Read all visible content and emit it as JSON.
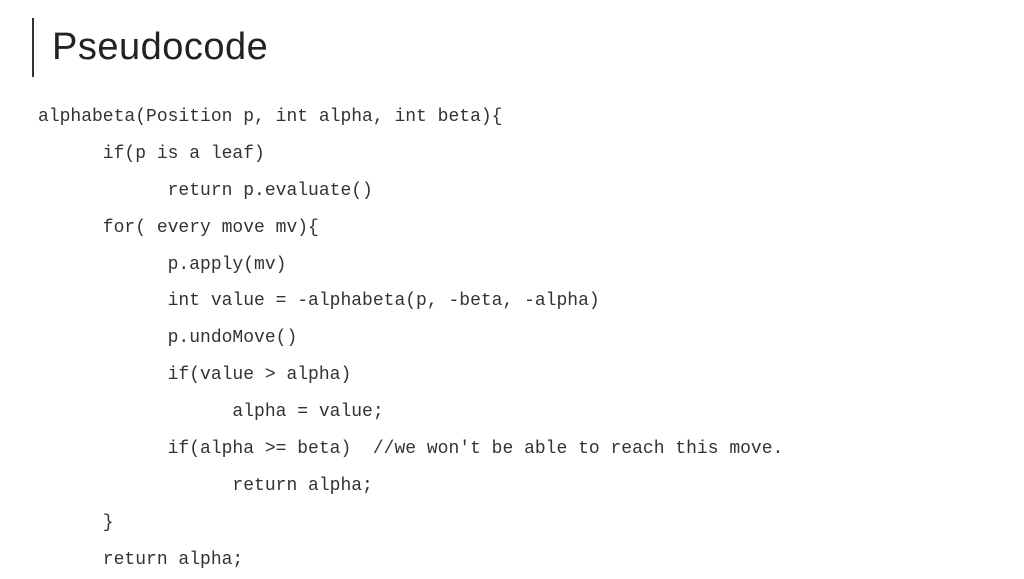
{
  "slide": {
    "title": "Pseudocode",
    "code": {
      "line1": "alphabeta(Position p, int alpha, int beta){",
      "line2": "      if(p is a leaf)",
      "line3": "            return p.evaluate()",
      "line4": "      for( every move mv){",
      "line5": "            p.apply(mv)",
      "line6": "            int value = -alphabeta(p, -beta, -alpha)",
      "line7": "            p.undoMove()",
      "line8": "            if(value > alpha)",
      "line9": "                  alpha = value;",
      "line10": "            if(alpha >= beta)  //we won't be able to reach this move.",
      "line11": "                  return alpha;",
      "line12": "      }",
      "line13": "      return alpha;"
    }
  }
}
